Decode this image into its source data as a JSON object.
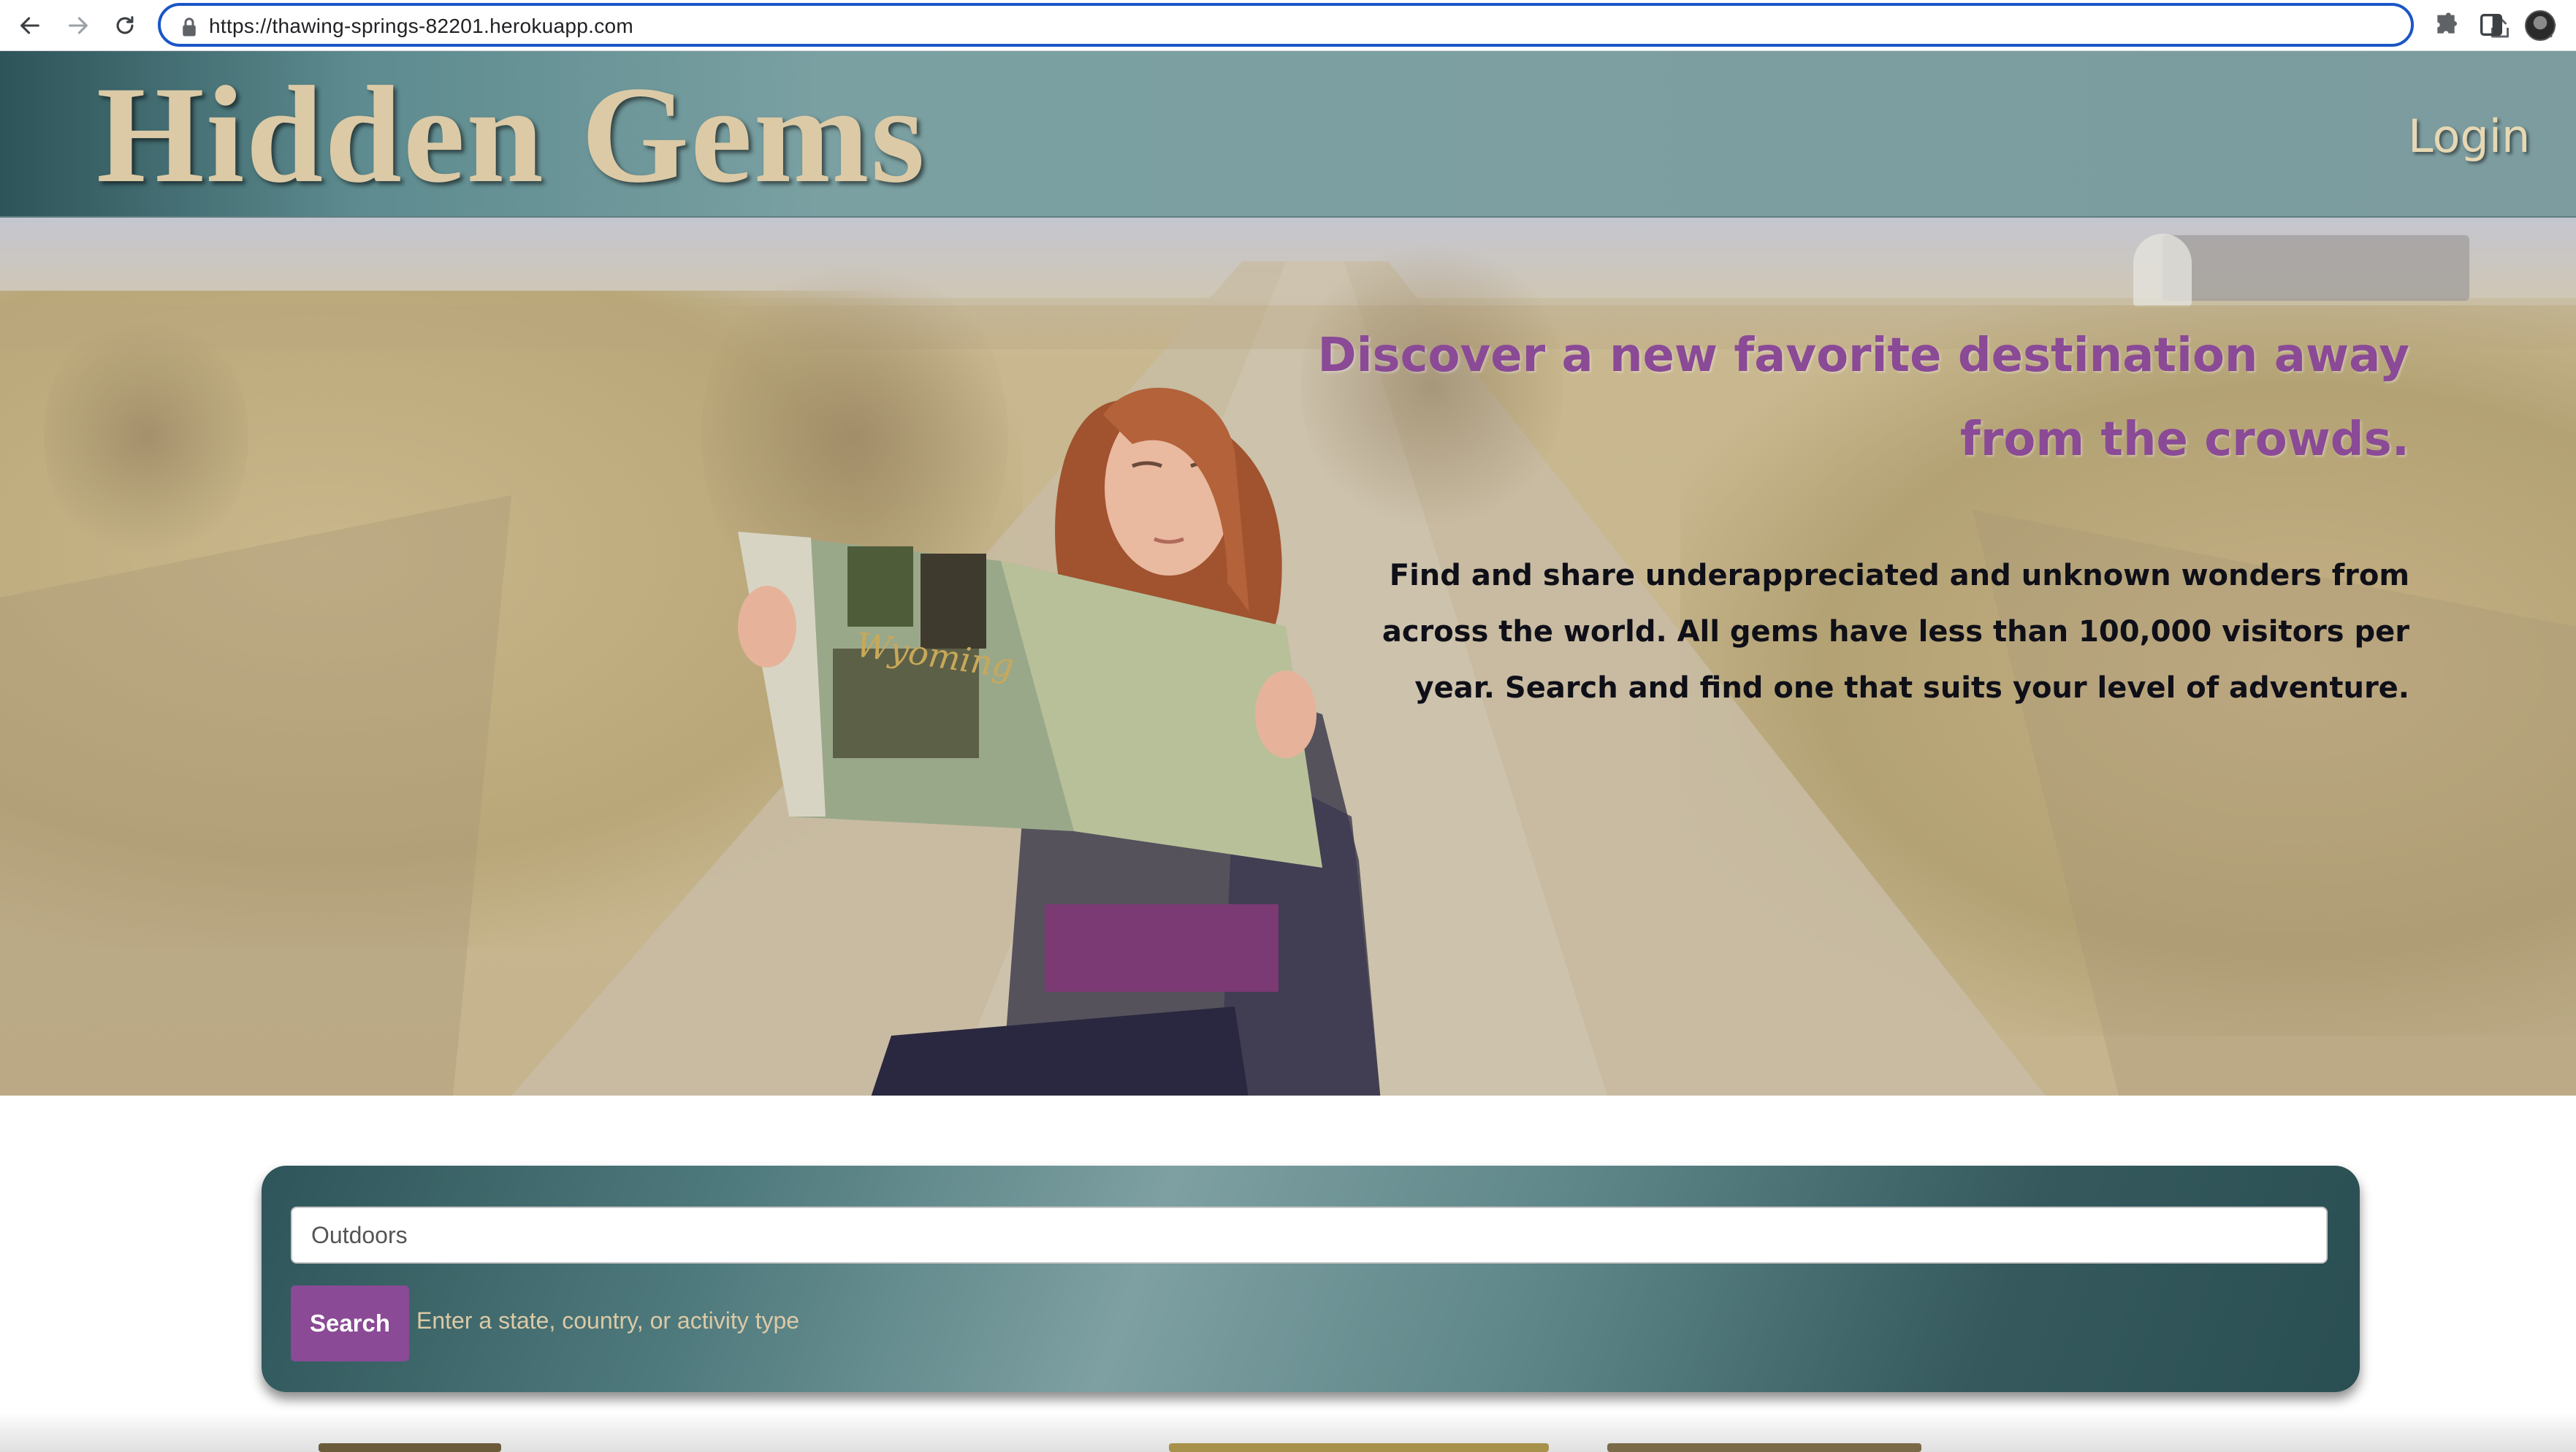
{
  "browser": {
    "url": "https://thawing-springs-82201.herokuapp.com"
  },
  "header": {
    "logo": "Hidden Gems",
    "login_label": "Login"
  },
  "hero": {
    "headline": "Discover a new favorite destination away from the crowds.",
    "body": "Find and share underappreciated and unknown wonders from across the world. All gems have less than 100,000 visitors per year. Search and find one that suits your level of adventure."
  },
  "search": {
    "input_value": "Outdoors",
    "button_label": "Search",
    "hint": "Enter a state, country, or activity type"
  },
  "colors": {
    "accent_purple": "#8a4a96",
    "header_teal": "#7aa0a2",
    "logo_tan": "#dccaa6"
  }
}
